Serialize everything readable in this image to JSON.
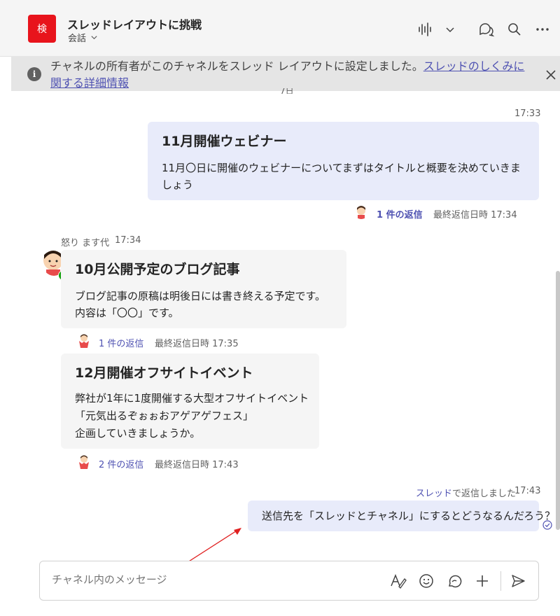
{
  "header": {
    "channel_icon_text": "検",
    "title": "スレッドレイアウトに挑戦",
    "tab_label": "会話",
    "brand_color": "#e8141c"
  },
  "banner": {
    "text": "チャネルの所有者がこのチャネルをスレッド レイアウトに設定しました。",
    "link": "スレッドのしくみに関する詳細情報",
    "clipped_text": "7日"
  },
  "messages": [
    {
      "time": "17:33",
      "title": "11月開催ウェビナー",
      "body": "11月〇日に開催のウェビナーについてまずはタイトルと概要を決めていきましょう",
      "reply_count": "1 件の返信",
      "reply_meta": "最終返信日時 17:34"
    },
    {
      "author": "怒り ます代",
      "time": "17:34",
      "title": "10月公開予定のブログ記事",
      "body": [
        "ブログ記事の原稿は明後日には書き終える予定です。",
        "内容は「〇〇」です。"
      ],
      "reply_count": "1 件の返信",
      "reply_meta": "最終返信日時 17:35"
    },
    {
      "title": "12月開催オフサイトイベント",
      "body": [
        "弊社が1年に1度開催する大型オフサイトイベント",
        "「元気出るぞぉぉおアゲアゲフェス」",
        "企画していきましょうか。"
      ],
      "reply_count": "2 件の返信",
      "reply_meta": "最終返信日時 17:43"
    },
    {
      "thread_link": "スレッド",
      "thread_suffix": "で返信しました",
      "time": "17:43",
      "body": "送信先を「スレッドとチャネル」にするとどうなるんだろう？"
    }
  ],
  "compose": {
    "placeholder": "チャネル内のメッセージ"
  },
  "colors": {
    "accent": "#4f52b2",
    "my_bubble": "#e8ebfa",
    "other_bubble": "#f5f5f5",
    "annotation_arrow": "#e02020"
  },
  "icons": [
    "audio-waveform-icon",
    "chevron-down-icon",
    "chat-bubbles-icon",
    "search-icon",
    "more-icon",
    "info-icon",
    "close-icon",
    "format-icon",
    "emoji-icon",
    "loop-icon",
    "plus-icon",
    "send-icon",
    "read-receipt-icon"
  ]
}
